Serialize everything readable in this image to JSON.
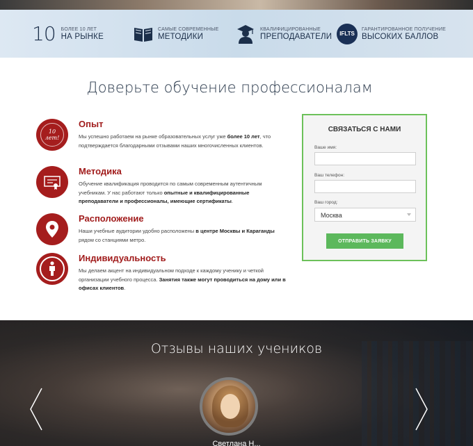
{
  "features": [
    {
      "big": "10",
      "small": "Более 10 лет",
      "label": "на рынке"
    },
    {
      "small": "Самые современные",
      "label": "методики",
      "icon": "book-icon"
    },
    {
      "small": "Квалифицированные",
      "label": "преподаватели",
      "icon": "graduate-icon"
    },
    {
      "icon_text": "IFLTS",
      "small": "Гарантированное получение",
      "label": "высоких баллов"
    }
  ],
  "main_title": "Доверьте обучение профессионалам",
  "items": [
    {
      "title": "Опыт",
      "badge_text": "10 лет!",
      "desc_parts": [
        "Мы успешно работаем на рынке образовательных услуг уже ",
        "более 10 лет",
        ", что подтверждается благодарными отзывами наших многочисленных клиентов."
      ]
    },
    {
      "title": "Методика",
      "desc_parts": [
        "Обучение квалификация проводится по самым современным аутентичным учебникам. У нас работают только ",
        "опытные и квалифицированные преподаватели и профессионалы, имеющие сертификаты",
        "."
      ]
    },
    {
      "title": "Расположение",
      "desc_parts": [
        "Наши учебные аудитории удобно расположены ",
        "в центре Москвы и Караганды",
        " рядом со станциями метро."
      ]
    },
    {
      "title": "Индивидуальность",
      "desc_parts": [
        "Мы делаем акцент на индивидуальном подходе к каждому ученику и четкой организации учебного процесса. ",
        "Занятия также могут проводиться на дому или в офисах клиентов",
        "."
      ]
    }
  ],
  "form": {
    "title": "СВЯЗАТЬСЯ С НАМИ",
    "name_label": "Ваше имя:",
    "phone_label": "Ваш телефон:",
    "city_label": "Ваш город:",
    "city_value": "Москва",
    "submit_label": "Отправить заявку"
  },
  "reviews": {
    "title": "Отзывы наших учеников",
    "name": "Светлана Н..."
  },
  "colors": {
    "accent_red": "#a51d1d",
    "accent_green": "#5cb85c",
    "navy": "#1c2f4a"
  }
}
